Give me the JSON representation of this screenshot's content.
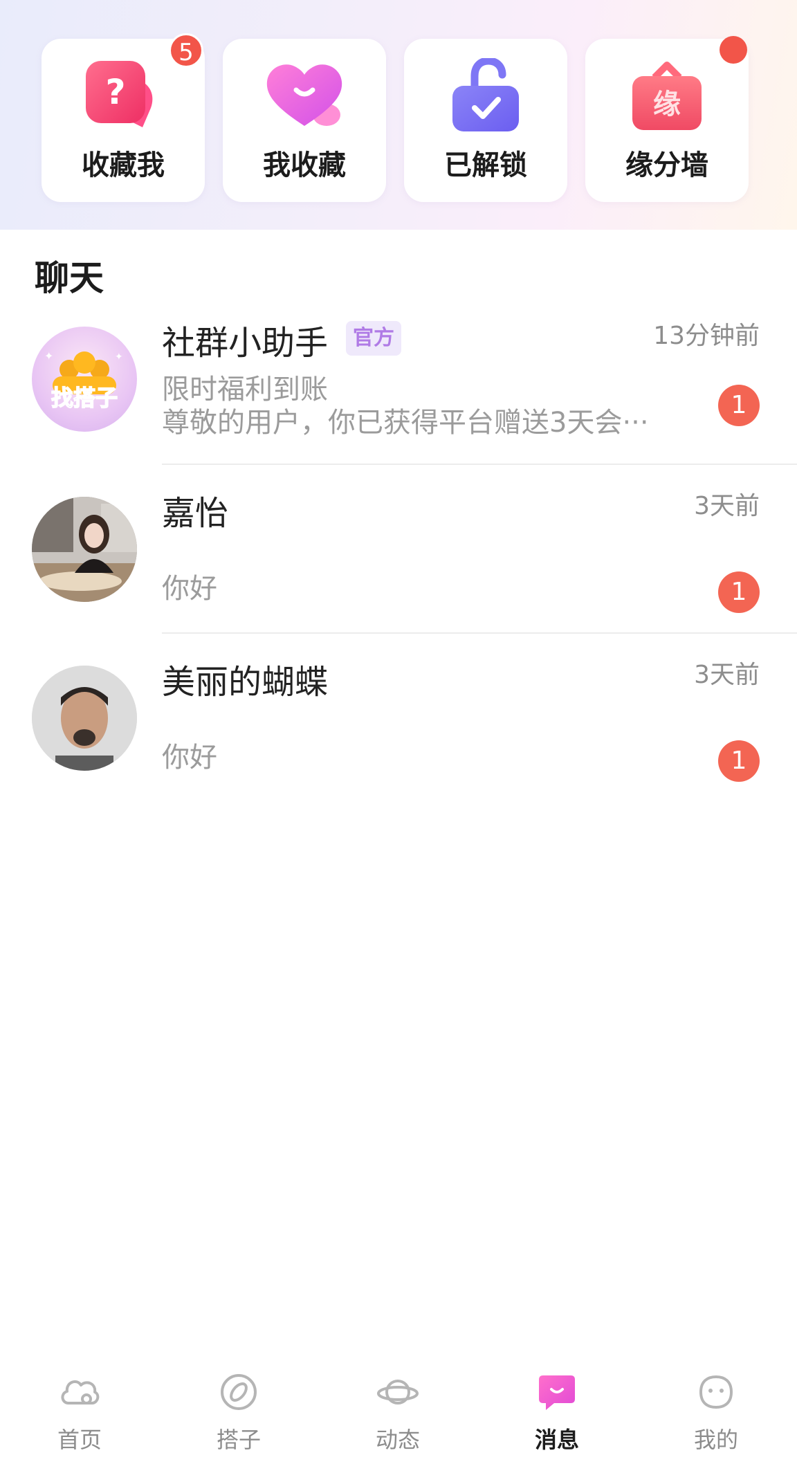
{
  "quick_cards": [
    {
      "label": "收藏我",
      "icon": "question-bubble-icon",
      "badge": "5"
    },
    {
      "label": "我收藏",
      "icon": "heart-icon",
      "badge": ""
    },
    {
      "label": "已解锁",
      "icon": "unlock-icon",
      "badge": ""
    },
    {
      "label": "缘分墙",
      "icon": "fate-bag-icon",
      "badge": "dot"
    }
  ],
  "chat": {
    "title": "聊天",
    "items": [
      {
        "name": "社群小助手",
        "tag": "官方",
        "time": "13分钟前",
        "preview_line1": "限时福利到账",
        "preview_line2": "尊敬的用户，你已获得平台赠送3天会···",
        "unread": "1",
        "avatar_text": "找搭子"
      },
      {
        "name": "嘉怡",
        "time": "3天前",
        "preview_line1": "你好",
        "unread": "1"
      },
      {
        "name": "美丽的蝴蝶",
        "time": "3天前",
        "preview_line1": "你好",
        "unread": "1"
      }
    ]
  },
  "tabbar": {
    "items": [
      {
        "label": "首页",
        "icon": "home-cloud-icon"
      },
      {
        "label": "搭子",
        "icon": "compass-icon"
      },
      {
        "label": "动态",
        "icon": "planet-icon"
      },
      {
        "label": "消息",
        "icon": "message-icon",
        "active": true
      },
      {
        "label": "我的",
        "icon": "face-icon"
      }
    ]
  },
  "colors": {
    "badge_red": "#f25549",
    "unread_red": "#f36553",
    "tag_purple": "#b07be6",
    "active_pink": "#ee59c9"
  }
}
